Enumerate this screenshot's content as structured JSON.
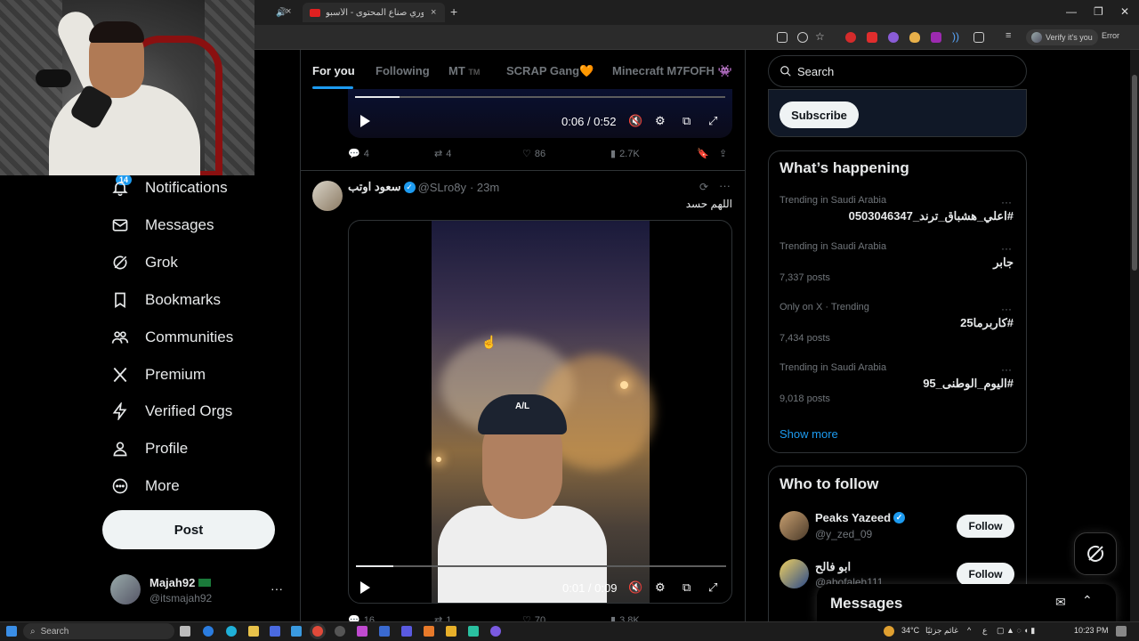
{
  "browser": {
    "tab_title": "دوري صناع المحتوى - الأسبو",
    "tab_close": "×",
    "new_tab": "+",
    "window_min": "—",
    "window_max": "❐",
    "window_close": "✕",
    "verify_label": "Verify it's you",
    "error_label": "Error"
  },
  "sidebar": {
    "notif_badge": "14",
    "items": [
      {
        "label": "Notifications",
        "icon": "bell-icon"
      },
      {
        "label": "Messages",
        "icon": "envelope-icon"
      },
      {
        "label": "Grok",
        "icon": "grok-icon"
      },
      {
        "label": "Bookmarks",
        "icon": "bookmark-icon"
      },
      {
        "label": "Communities",
        "icon": "communities-icon"
      },
      {
        "label": "Premium",
        "icon": "x-logo-icon"
      },
      {
        "label": "Verified Orgs",
        "icon": "lightning-icon"
      },
      {
        "label": "Profile",
        "icon": "person-icon"
      },
      {
        "label": "More",
        "icon": "more-circle-icon"
      }
    ],
    "post_label": "Post",
    "account": {
      "name": "Majah92",
      "handle": "@itsmajah92",
      "more": "···"
    }
  },
  "feed": {
    "tabs": [
      "For you",
      "Following",
      "MT",
      "SCRAP Gang🧡",
      "Minecraft M7FOFH 👾"
    ],
    "tab_mt_suffix": "TM",
    "tweet1": {
      "video_time": "0:06 / 0:52",
      "progress": 0.12,
      "replies": "4",
      "reposts": "4",
      "likes": "86",
      "views": "2.7K"
    },
    "tweet2": {
      "name": "سعود اوتب",
      "handle": "@SLro8y",
      "time": "· 23m",
      "text": "اللهم حسد",
      "video_time": "0:01 / 0:09",
      "progress": 0.1,
      "replies": "16",
      "reposts": "1",
      "likes": "70",
      "views": "3.8K",
      "cap_text": "A/L"
    }
  },
  "right": {
    "search_placeholder": "Search",
    "subscribe_label": "Subscribe",
    "happening_title": "What’s happening",
    "trends": [
      {
        "context": "Trending in Saudi Arabia",
        "name": "#اعلي_هشباق_ترند_0503046347",
        "posts": ""
      },
      {
        "context": "Trending in Saudi Arabia",
        "name": "جابر",
        "posts": "7,337 posts"
      },
      {
        "context": "Only on X · Trending",
        "name": "#كاربرما25",
        "posts": "7,434 posts"
      },
      {
        "context": "Trending in Saudi Arabia",
        "name": "#اليوم_الوطنى_95",
        "posts": "9,018 posts"
      }
    ],
    "trend_more": "···",
    "show_more": "Show more",
    "wtf_title": "Who to follow",
    "wtf": [
      {
        "name": "Peaks Yazeed",
        "handle": "@y_zed_09",
        "follow": "Follow"
      },
      {
        "name": "ابو فالح",
        "handle": "@abofaleh111",
        "follow": "Follow"
      }
    ],
    "messages_label": "Messages"
  },
  "taskbar": {
    "search_label": "Search",
    "weather": "34°C",
    "weather_text": "غائم جزئيًا",
    "lang": "ع",
    "time": "10:23 PM"
  },
  "colors": {
    "accent": "#1d9bf0",
    "background": "#000000",
    "text": "#e7e9ea",
    "muted": "#71767b"
  }
}
